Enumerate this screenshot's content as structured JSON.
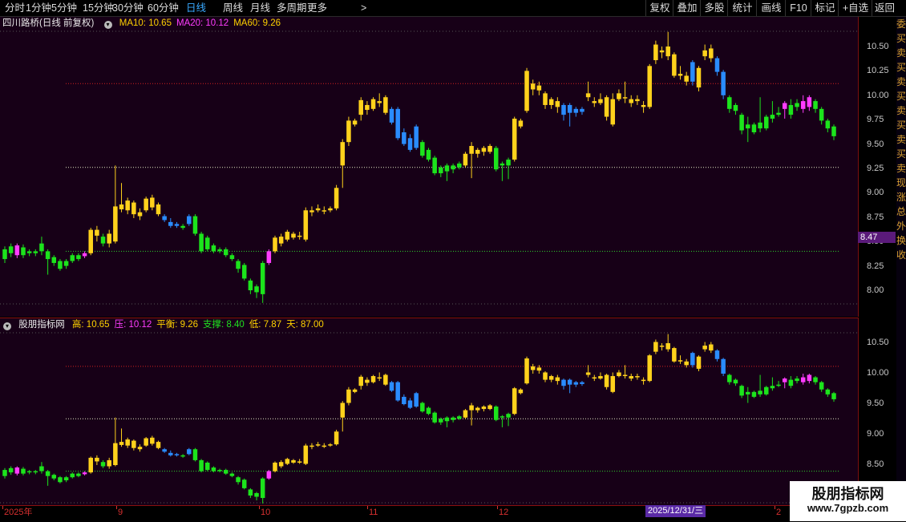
{
  "toolbar": {
    "periods": [
      "分时",
      "1分钟",
      "5分钟",
      "15分钟",
      "30分钟",
      "60分钟",
      "日线",
      "周线",
      "月线",
      "多周期",
      "更多"
    ],
    "active_period": "日线",
    "more_glyph": ">",
    "right_buttons": [
      "复权",
      "叠加",
      "多股",
      "统计",
      "画线",
      "F10",
      "标记",
      "+自选",
      "返回"
    ]
  },
  "main_panel": {
    "title": "四川路桥(日线 前复权)",
    "indicators": [
      {
        "label": "MA10: 10.65",
        "color": "#ffd200"
      },
      {
        "label": "MA20: 10.12",
        "color": "#ff3cff"
      },
      {
        "label": "MA60: 9.26",
        "color": "#ffd200"
      }
    ],
    "axis_ticks": [
      "10.50",
      "10.25",
      "10.00",
      "9.75",
      "9.50",
      "9.25",
      "9.00",
      "8.75",
      "8.50",
      "8.25",
      "8.00"
    ],
    "current_price_tag": "8.47"
  },
  "sub_panel": {
    "title": "股朋指标网",
    "indicators": [
      {
        "label": "高: 10.65",
        "color": "#ffd200"
      },
      {
        "label": "压: 10.12",
        "color": "#ff3cff"
      },
      {
        "label": "平衡: 9.26",
        "color": "#ffd200"
      },
      {
        "label": "支撑: 8.40",
        "color": "#20e020"
      },
      {
        "label": "低: 7.87",
        "color": "#ffd200"
      },
      {
        "label": "天: 87.00",
        "color": "#ffd200"
      }
    ],
    "axis_ticks": [
      "10.50",
      "10.00",
      "9.50",
      "9.00",
      "8.50"
    ]
  },
  "date_axis": {
    "labels": [
      "2025年",
      "9",
      "10",
      "11",
      "12",
      "2"
    ],
    "cursor_date": "2025/12/31/三"
  },
  "right_strip_chars": [
    "委",
    "买",
    "卖",
    "买",
    "卖",
    "买",
    "卖",
    "买",
    "卖",
    "买",
    "卖",
    "现",
    "涨",
    "总",
    "外",
    "换",
    "收"
  ],
  "watermark": {
    "title": "股朋指标网",
    "url": "www.7gpzb.com"
  },
  "colors": {
    "up": "#ffd21c",
    "down": "#1ce41c",
    "strong_down": "#2a8cff",
    "strong_up": "#ff3cff",
    "resistance": "#d62020",
    "balance": "#e8e8c8",
    "support": "#30d030"
  },
  "chart_data": {
    "type": "candlestick",
    "title": "四川路桥(日线 前复权)",
    "price_range": [
      7.87,
      10.65
    ],
    "reference_lines": {
      "resistance": 10.12,
      "balance": 9.26,
      "support": 8.4
    },
    "candles": [
      {
        "o": 8.32,
        "c": 8.42,
        "h": 8.45,
        "l": 8.28,
        "t": "d"
      },
      {
        "o": 8.38,
        "c": 8.45,
        "h": 8.48,
        "l": 8.34,
        "t": "d"
      },
      {
        "o": 8.36,
        "c": 8.46,
        "h": 8.48,
        "l": 8.33,
        "t": "m"
      },
      {
        "o": 8.44,
        "c": 8.36,
        "h": 8.47,
        "l": 8.33,
        "t": "d"
      },
      {
        "o": 8.38,
        "c": 8.4,
        "h": 8.42,
        "l": 8.35,
        "t": "d"
      },
      {
        "o": 8.4,
        "c": 8.38,
        "h": 8.42,
        "l": 8.35,
        "t": "d"
      },
      {
        "o": 8.4,
        "c": 8.48,
        "h": 8.55,
        "l": 8.36,
        "t": "d"
      },
      {
        "o": 8.4,
        "c": 8.32,
        "h": 8.42,
        "l": 8.16,
        "t": "d"
      },
      {
        "o": 8.34,
        "c": 8.28,
        "h": 8.36,
        "l": 8.25,
        "t": "d"
      },
      {
        "o": 8.3,
        "c": 8.22,
        "h": 8.32,
        "l": 8.2,
        "t": "d"
      },
      {
        "o": 8.25,
        "c": 8.3,
        "h": 8.32,
        "l": 8.22,
        "t": "d"
      },
      {
        "o": 8.3,
        "c": 8.36,
        "h": 8.38,
        "l": 8.28,
        "t": "d"
      },
      {
        "o": 8.32,
        "c": 8.36,
        "h": 8.38,
        "l": 8.3,
        "t": "d"
      },
      {
        "o": 8.35,
        "c": 8.38,
        "h": 8.4,
        "l": 8.33,
        "t": "m"
      },
      {
        "o": 8.38,
        "c": 8.62,
        "h": 8.64,
        "l": 8.36,
        "t": "u"
      },
      {
        "o": 8.56,
        "c": 8.62,
        "h": 8.66,
        "l": 8.5,
        "t": "u"
      },
      {
        "o": 8.55,
        "c": 8.48,
        "h": 8.58,
        "l": 8.45,
        "t": "d"
      },
      {
        "o": 8.48,
        "c": 8.58,
        "h": 8.62,
        "l": 8.44,
        "t": "u"
      },
      {
        "o": 8.5,
        "c": 8.86,
        "h": 9.28,
        "l": 8.48,
        "t": "u"
      },
      {
        "o": 8.88,
        "c": 8.83,
        "h": 9.1,
        "l": 8.8,
        "t": "u"
      },
      {
        "o": 8.82,
        "c": 8.92,
        "h": 8.95,
        "l": 8.78,
        "t": "u"
      },
      {
        "o": 8.9,
        "c": 8.78,
        "h": 8.92,
        "l": 8.74,
        "t": "u"
      },
      {
        "o": 8.8,
        "c": 8.76,
        "h": 8.84,
        "l": 8.72,
        "t": "u"
      },
      {
        "o": 8.82,
        "c": 8.94,
        "h": 8.96,
        "l": 8.8,
        "t": "u"
      },
      {
        "o": 8.95,
        "c": 8.85,
        "h": 8.98,
        "l": 8.82,
        "t": "u"
      },
      {
        "o": 8.88,
        "c": 8.78,
        "h": 8.9,
        "l": 8.76,
        "t": "u"
      },
      {
        "o": 8.76,
        "c": 8.72,
        "h": 8.78,
        "l": 8.7,
        "t": "b"
      },
      {
        "o": 8.7,
        "c": 8.66,
        "h": 8.74,
        "l": 8.64,
        "t": "b"
      },
      {
        "o": 8.68,
        "c": 8.66,
        "h": 8.7,
        "l": 8.64,
        "t": "b"
      },
      {
        "o": 8.64,
        "c": 8.66,
        "h": 8.68,
        "l": 8.62,
        "t": "d"
      },
      {
        "o": 8.68,
        "c": 8.76,
        "h": 8.78,
        "l": 8.66,
        "t": "b"
      },
      {
        "o": 8.76,
        "c": 8.58,
        "h": 8.78,
        "l": 8.56,
        "t": "d"
      },
      {
        "o": 8.58,
        "c": 8.4,
        "h": 8.6,
        "l": 8.38,
        "t": "d"
      },
      {
        "o": 8.54,
        "c": 8.42,
        "h": 8.56,
        "l": 8.4,
        "t": "d"
      },
      {
        "o": 8.46,
        "c": 8.4,
        "h": 8.48,
        "l": 8.38,
        "t": "d"
      },
      {
        "o": 8.4,
        "c": 8.42,
        "h": 8.44,
        "l": 8.38,
        "t": "d"
      },
      {
        "o": 8.42,
        "c": 8.36,
        "h": 8.44,
        "l": 8.34,
        "t": "d"
      },
      {
        "o": 8.36,
        "c": 8.32,
        "h": 8.38,
        "l": 8.3,
        "t": "d"
      },
      {
        "o": 8.3,
        "c": 8.22,
        "h": 8.32,
        "l": 8.18,
        "t": "d"
      },
      {
        "o": 8.26,
        "c": 8.12,
        "h": 8.28,
        "l": 8.1,
        "t": "d"
      },
      {
        "o": 8.1,
        "c": 8.0,
        "h": 8.12,
        "l": 7.96,
        "t": "d"
      },
      {
        "o": 8.04,
        "c": 7.98,
        "h": 8.06,
        "l": 7.92,
        "t": "d"
      },
      {
        "o": 8.28,
        "c": 7.96,
        "h": 8.3,
        "l": 7.87,
        "t": "d"
      },
      {
        "o": 8.28,
        "c": 8.4,
        "h": 8.42,
        "l": 8.26,
        "t": "m"
      },
      {
        "o": 8.4,
        "c": 8.54,
        "h": 8.56,
        "l": 8.38,
        "t": "u"
      },
      {
        "o": 8.48,
        "c": 8.55,
        "h": 8.58,
        "l": 8.45,
        "t": "u"
      },
      {
        "o": 8.52,
        "c": 8.6,
        "h": 8.62,
        "l": 8.5,
        "t": "u"
      },
      {
        "o": 8.58,
        "c": 8.54,
        "h": 8.6,
        "l": 8.52,
        "t": "u"
      },
      {
        "o": 8.56,
        "c": 8.56,
        "h": 8.6,
        "l": 8.52,
        "t": "u"
      },
      {
        "o": 8.52,
        "c": 8.82,
        "h": 8.85,
        "l": 8.5,
        "t": "u"
      },
      {
        "o": 8.82,
        "c": 8.8,
        "h": 8.86,
        "l": 8.76,
        "t": "u"
      },
      {
        "o": 8.82,
        "c": 8.84,
        "h": 8.88,
        "l": 8.8,
        "t": "u"
      },
      {
        "o": 8.82,
        "c": 8.82,
        "h": 8.86,
        "l": 8.78,
        "t": "u"
      },
      {
        "o": 8.82,
        "c": 8.84,
        "h": 8.86,
        "l": 8.8,
        "t": "u"
      },
      {
        "o": 8.84,
        "c": 9.05,
        "h": 9.08,
        "l": 8.82,
        "t": "u"
      },
      {
        "o": 9.28,
        "c": 9.52,
        "h": 9.55,
        "l": 9.05,
        "t": "u"
      },
      {
        "o": 9.52,
        "c": 9.74,
        "h": 9.78,
        "l": 9.48,
        "t": "u"
      },
      {
        "o": 9.7,
        "c": 9.74,
        "h": 9.76,
        "l": 9.68,
        "t": "u"
      },
      {
        "o": 9.8,
        "c": 9.95,
        "h": 9.98,
        "l": 9.74,
        "t": "u"
      },
      {
        "o": 9.85,
        "c": 9.9,
        "h": 9.94,
        "l": 9.8,
        "t": "u"
      },
      {
        "o": 9.86,
        "c": 9.96,
        "h": 9.98,
        "l": 9.84,
        "t": "u"
      },
      {
        "o": 9.92,
        "c": 9.94,
        "h": 10.02,
        "l": 9.88,
        "t": "u"
      },
      {
        "o": 9.82,
        "c": 9.98,
        "h": 10.0,
        "l": 9.8,
        "t": "u"
      },
      {
        "o": 9.86,
        "c": 9.72,
        "h": 9.88,
        "l": 9.7,
        "t": "b"
      },
      {
        "o": 9.86,
        "c": 9.56,
        "h": 9.88,
        "l": 9.54,
        "t": "b"
      },
      {
        "o": 9.62,
        "c": 9.5,
        "h": 9.66,
        "l": 9.48,
        "t": "b"
      },
      {
        "o": 9.56,
        "c": 9.44,
        "h": 9.6,
        "l": 9.42,
        "t": "b"
      },
      {
        "o": 9.68,
        "c": 9.46,
        "h": 9.7,
        "l": 9.44,
        "t": "b"
      },
      {
        "o": 9.52,
        "c": 9.38,
        "h": 9.54,
        "l": 9.36,
        "t": "d"
      },
      {
        "o": 9.44,
        "c": 9.34,
        "h": 9.46,
        "l": 9.32,
        "t": "d"
      },
      {
        "o": 9.36,
        "c": 9.2,
        "h": 9.38,
        "l": 9.18,
        "t": "d"
      },
      {
        "o": 9.26,
        "c": 9.2,
        "h": 9.28,
        "l": 9.16,
        "t": "d"
      },
      {
        "o": 9.22,
        "c": 9.28,
        "h": 9.3,
        "l": 9.12,
        "t": "d"
      },
      {
        "o": 9.24,
        "c": 9.28,
        "h": 9.3,
        "l": 9.2,
        "t": "d"
      },
      {
        "o": 9.26,
        "c": 9.3,
        "h": 9.32,
        "l": 9.24,
        "t": "d"
      },
      {
        "o": 9.28,
        "c": 9.4,
        "h": 9.42,
        "l": 9.26,
        "t": "u"
      },
      {
        "o": 9.4,
        "c": 9.48,
        "h": 9.52,
        "l": 9.15,
        "t": "u"
      },
      {
        "o": 9.44,
        "c": 9.4,
        "h": 9.46,
        "l": 9.36,
        "t": "u"
      },
      {
        "o": 9.42,
        "c": 9.46,
        "h": 9.48,
        "l": 9.38,
        "t": "u"
      },
      {
        "o": 9.42,
        "c": 9.48,
        "h": 9.5,
        "l": 9.4,
        "t": "u"
      },
      {
        "o": 9.46,
        "c": 9.24,
        "h": 9.48,
        "l": 9.22,
        "t": "d"
      },
      {
        "o": 9.3,
        "c": 9.28,
        "h": 9.32,
        "l": 9.12,
        "t": "d"
      },
      {
        "o": 9.28,
        "c": 9.34,
        "h": 9.36,
        "l": 9.14,
        "t": "d"
      },
      {
        "o": 9.34,
        "c": 9.76,
        "h": 9.78,
        "l": 9.32,
        "t": "u"
      },
      {
        "o": 9.68,
        "c": 9.74,
        "h": 9.76,
        "l": 9.66,
        "t": "u"
      },
      {
        "o": 9.84,
        "c": 10.25,
        "h": 10.28,
        "l": 9.82,
        "t": "u"
      },
      {
        "o": 10.12,
        "c": 10.06,
        "h": 10.16,
        "l": 10.0,
        "t": "u"
      },
      {
        "o": 10.1,
        "c": 10.05,
        "h": 10.14,
        "l": 10.0,
        "t": "u"
      },
      {
        "o": 10.02,
        "c": 9.9,
        "h": 10.04,
        "l": 9.86,
        "t": "u"
      },
      {
        "o": 9.96,
        "c": 9.9,
        "h": 9.98,
        "l": 9.86,
        "t": "u"
      },
      {
        "o": 9.94,
        "c": 9.88,
        "h": 9.98,
        "l": 9.82,
        "t": "u"
      },
      {
        "o": 9.9,
        "c": 9.8,
        "h": 9.92,
        "l": 9.74,
        "t": "b"
      },
      {
        "o": 9.9,
        "c": 9.82,
        "h": 9.92,
        "l": 9.68,
        "t": "b"
      },
      {
        "o": 9.86,
        "c": 9.82,
        "h": 9.88,
        "l": 9.78,
        "t": "b"
      },
      {
        "o": 9.86,
        "c": 9.83,
        "h": 9.88,
        "l": 9.8,
        "t": "b"
      },
      {
        "o": 9.98,
        "c": 10.02,
        "h": 10.14,
        "l": 9.94,
        "t": "u"
      },
      {
        "o": 9.94,
        "c": 9.92,
        "h": 9.98,
        "l": 9.88,
        "t": "u"
      },
      {
        "o": 9.92,
        "c": 9.96,
        "h": 10.02,
        "l": 9.9,
        "t": "u"
      },
      {
        "o": 9.78,
        "c": 9.98,
        "h": 10.0,
        "l": 9.74,
        "t": "u"
      },
      {
        "o": 9.96,
        "c": 9.7,
        "h": 10.02,
        "l": 9.68,
        "t": "u"
      },
      {
        "o": 9.96,
        "c": 10.02,
        "h": 10.06,
        "l": 9.94,
        "t": "u"
      },
      {
        "o": 9.98,
        "c": 9.98,
        "h": 10.14,
        "l": 9.92,
        "t": "u"
      },
      {
        "o": 9.96,
        "c": 9.92,
        "h": 10.0,
        "l": 9.88,
        "t": "u"
      },
      {
        "o": 9.94,
        "c": 9.96,
        "h": 10.0,
        "l": 9.9,
        "t": "u"
      },
      {
        "o": 9.88,
        "c": 9.9,
        "h": 9.94,
        "l": 9.82,
        "t": "u"
      },
      {
        "o": 9.88,
        "c": 10.3,
        "h": 10.32,
        "l": 9.86,
        "t": "u"
      },
      {
        "o": 10.36,
        "c": 10.52,
        "h": 10.56,
        "l": 10.32,
        "t": "u"
      },
      {
        "o": 10.44,
        "c": 10.46,
        "h": 10.5,
        "l": 10.38,
        "t": "u"
      },
      {
        "o": 10.5,
        "c": 10.4,
        "h": 10.65,
        "l": 10.36,
        "t": "u"
      },
      {
        "o": 10.42,
        "c": 10.2,
        "h": 10.44,
        "l": 10.18,
        "t": "u"
      },
      {
        "o": 10.22,
        "c": 10.2,
        "h": 10.3,
        "l": 10.16,
        "t": "u"
      },
      {
        "o": 10.2,
        "c": 10.14,
        "h": 10.24,
        "l": 10.1,
        "t": "u"
      },
      {
        "o": 10.34,
        "c": 10.14,
        "h": 10.36,
        "l": 10.1,
        "t": "b"
      },
      {
        "o": 10.08,
        "c": 10.28,
        "h": 10.3,
        "l": 10.04,
        "t": "u"
      },
      {
        "o": 10.4,
        "c": 10.46,
        "h": 10.52,
        "l": 10.36,
        "t": "u"
      },
      {
        "o": 10.48,
        "c": 10.38,
        "h": 10.52,
        "l": 10.34,
        "t": "u"
      },
      {
        "o": 10.38,
        "c": 10.24,
        "h": 10.4,
        "l": 10.2,
        "t": "b"
      },
      {
        "o": 10.24,
        "c": 10.0,
        "h": 10.26,
        "l": 9.96,
        "t": "b"
      },
      {
        "o": 9.98,
        "c": 9.86,
        "h": 10.0,
        "l": 9.82,
        "t": "d"
      },
      {
        "o": 9.9,
        "c": 9.84,
        "h": 9.92,
        "l": 9.8,
        "t": "d"
      },
      {
        "o": 9.8,
        "c": 9.64,
        "h": 9.82,
        "l": 9.6,
        "t": "d"
      },
      {
        "o": 9.7,
        "c": 9.66,
        "h": 9.78,
        "l": 9.52,
        "t": "d"
      },
      {
        "o": 9.62,
        "c": 9.7,
        "h": 9.72,
        "l": 9.6,
        "t": "d"
      },
      {
        "o": 9.66,
        "c": 9.72,
        "h": 9.98,
        "l": 9.62,
        "t": "d"
      },
      {
        "o": 9.66,
        "c": 9.78,
        "h": 9.8,
        "l": 9.64,
        "t": "d"
      },
      {
        "o": 9.76,
        "c": 9.8,
        "h": 9.94,
        "l": 9.72,
        "t": "d"
      },
      {
        "o": 9.8,
        "c": 9.82,
        "h": 9.88,
        "l": 9.78,
        "t": "d"
      },
      {
        "o": 9.86,
        "c": 9.92,
        "h": 9.94,
        "l": 9.76,
        "t": "m"
      },
      {
        "o": 9.8,
        "c": 9.9,
        "h": 9.96,
        "l": 9.76,
        "t": "d"
      },
      {
        "o": 9.88,
        "c": 9.92,
        "h": 9.96,
        "l": 9.84,
        "t": "d"
      },
      {
        "o": 9.86,
        "c": 9.94,
        "h": 10.0,
        "l": 9.82,
        "t": "m"
      },
      {
        "o": 9.88,
        "c": 9.98,
        "h": 10.0,
        "l": 9.84,
        "t": "m"
      },
      {
        "o": 9.94,
        "c": 9.86,
        "h": 9.96,
        "l": 9.82,
        "t": "d"
      },
      {
        "o": 9.86,
        "c": 9.74,
        "h": 9.88,
        "l": 9.7,
        "t": "d"
      },
      {
        "o": 9.74,
        "c": 9.66,
        "h": 9.76,
        "l": 9.62,
        "t": "d"
      },
      {
        "o": 9.68,
        "c": 9.58,
        "h": 9.7,
        "l": 9.54,
        "t": "d"
      }
    ]
  }
}
